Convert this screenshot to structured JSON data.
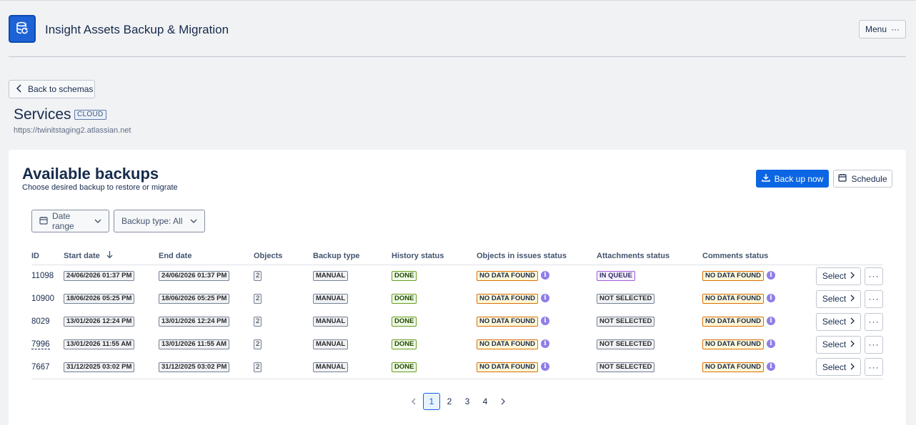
{
  "app": {
    "title": "Insight Assets Backup & Migration",
    "menu_label": "Menu",
    "back_label": "Back to schemas"
  },
  "schema": {
    "name": "Services",
    "badge": "CLOUD",
    "url": "https://twinitstaging2.atlassian.net"
  },
  "panel": {
    "title": "Available backups",
    "subtitle": "Choose desired backup to restore or migrate",
    "backup_now": "Back up now",
    "schedule": "Schedule",
    "filter_date": "Date range",
    "filter_type": "Backup type: All"
  },
  "table": {
    "headers": [
      "ID",
      "Start date",
      "End date",
      "Objects",
      "Backup type",
      "History status",
      "Objects in issues status",
      "Attachments status",
      "Comments status"
    ],
    "select_label": "Select",
    "rows": [
      {
        "id": "11098",
        "start": "24/06/2026 01:37 PM",
        "end": "24/06/2026 01:37 PM",
        "objects": "2",
        "type": "MANUAL",
        "history": "DONE",
        "issues": "NO DATA FOUND",
        "attachments": "IN QUEUE",
        "comments": "NO DATA FOUND"
      },
      {
        "id": "10900",
        "start": "18/06/2026 05:25 PM",
        "end": "18/06/2026 05:25 PM",
        "objects": "2",
        "type": "MANUAL",
        "history": "DONE",
        "issues": "NO DATA FOUND",
        "attachments": "NOT SELECTED",
        "comments": "NO DATA FOUND"
      },
      {
        "id": "8029",
        "start": "13/01/2026 12:24 PM",
        "end": "13/01/2026 12:24 PM",
        "objects": "2",
        "type": "MANUAL",
        "history": "DONE",
        "issues": "NO DATA FOUND",
        "attachments": "NOT SELECTED",
        "comments": "NO DATA FOUND"
      },
      {
        "id": "7996",
        "start": "13/01/2026 11:55 AM",
        "end": "13/01/2026 11:55 AM",
        "objects": "2",
        "type": "MANUAL",
        "history": "DONE",
        "issues": "NO DATA FOUND",
        "attachments": "NOT SELECTED",
        "comments": "NO DATA FOUND"
      },
      {
        "id": "7667",
        "start": "31/12/2025 03:02 PM",
        "end": "31/12/2025 03:02 PM",
        "objects": "2",
        "type": "MANUAL",
        "history": "DONE",
        "issues": "NO DATA FOUND",
        "attachments": "NOT SELECTED",
        "comments": "NO DATA FOUND"
      }
    ]
  },
  "pagination": {
    "pages": [
      "1",
      "2",
      "3",
      "4"
    ],
    "current": "1"
  },
  "colors": {
    "primary": "#0c66e4",
    "done": "#6a9a23",
    "nodata": "#d97008",
    "queue": "#9f5ddb",
    "info": "#8f7ee7"
  },
  "icons": [
    "app-logo-icon",
    "more-dots-icon",
    "chevron-left-icon",
    "download-icon",
    "calendar-icon",
    "chevron-down-icon",
    "sort-down-icon",
    "info-icon",
    "chevron-right-icon"
  ]
}
